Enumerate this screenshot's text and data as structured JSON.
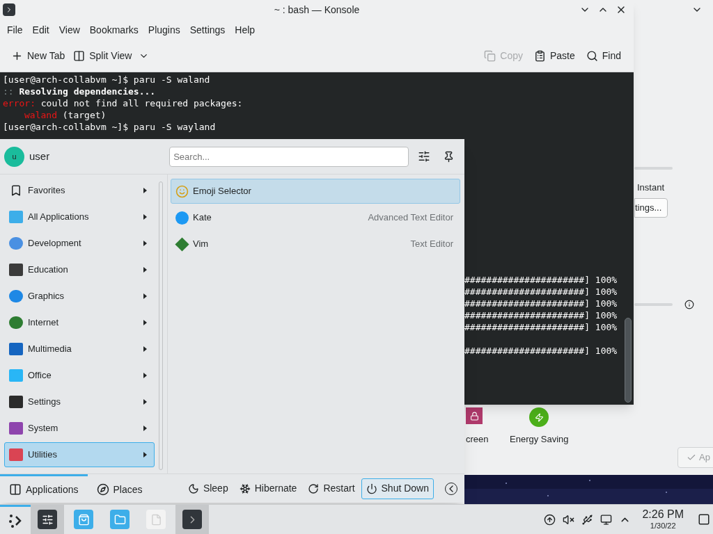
{
  "settings_window": {
    "slider_label": "Instant",
    "button": "tings...",
    "items": [
      {
        "label": "creen"
      },
      {
        "label": "Energy Saving"
      }
    ],
    "apply": "Ap"
  },
  "konsole": {
    "title": "~ : bash — Konsole",
    "menu": [
      "File",
      "Edit",
      "View",
      "Bookmarks",
      "Plugins",
      "Settings",
      "Help"
    ],
    "toolbar_left": [
      {
        "label": "New Tab",
        "kind": "new-tab"
      },
      {
        "label": "Split View",
        "kind": "split"
      }
    ],
    "toolbar_right": [
      {
        "label": "Copy",
        "kind": "copy",
        "disabled": true
      },
      {
        "label": "Paste",
        "kind": "paste",
        "disabled": false
      },
      {
        "label": "Find",
        "kind": "find",
        "disabled": false
      }
    ],
    "lines": [
      {
        "indent": false,
        "segments": [
          {
            "text": "[user@arch-collabvm ~]$ paru -S waland",
            "kind": "normal"
          }
        ]
      },
      {
        "indent": false,
        "segments": [
          {
            "text": "::",
            "kind": "dim"
          },
          {
            "text": " Resolving dependencies...",
            "kind": "bold"
          }
        ]
      },
      {
        "indent": false,
        "segments": [
          {
            "text": "error:",
            "kind": "error"
          },
          {
            "text": " could not find all required packages:",
            "kind": "normal"
          }
        ]
      },
      {
        "indent": true,
        "segments": [
          {
            "text": "waland",
            "kind": "error"
          },
          {
            "text": " (target)",
            "kind": "normal"
          }
        ]
      },
      {
        "indent": false,
        "segments": [
          {
            "text": "[user@arch-collabvm ~]$ paru -S wayland",
            "kind": "normal"
          }
        ]
      }
    ],
    "progress_groups": [
      [
        "######################] 100%",
        "######################] 100%",
        "######################] 100%",
        "######################] 100%",
        "######################] 100%"
      ],
      [
        "######################] 100%"
      ]
    ]
  },
  "launcher": {
    "user": {
      "name": "user",
      "initial": "u"
    },
    "search": {
      "placeholder": "Search..."
    },
    "categories": [
      {
        "label": "Favorites",
        "selected": false
      },
      {
        "label": "All Applications",
        "selected": false
      },
      {
        "label": "Development",
        "selected": false
      },
      {
        "label": "Education",
        "selected": false
      },
      {
        "label": "Graphics",
        "selected": false
      },
      {
        "label": "Internet",
        "selected": false
      },
      {
        "label": "Multimedia",
        "selected": false
      },
      {
        "label": "Office",
        "selected": false
      },
      {
        "label": "Settings",
        "selected": false
      },
      {
        "label": "System",
        "selected": false
      },
      {
        "label": "Utilities",
        "selected": true
      }
    ],
    "apps": [
      {
        "name": "Emoji Selector",
        "selected": true
      },
      {
        "name": "Kate",
        "description": "Advanced Text Editor",
        "selected": false
      },
      {
        "name": "Vim",
        "description": "Text Editor",
        "selected": false
      }
    ],
    "tabs": [
      {
        "label": "Applications",
        "selected": true
      },
      {
        "label": "Places",
        "selected": false
      }
    ],
    "power": [
      {
        "label": "Sleep",
        "kind": "sleep",
        "hovered": false
      },
      {
        "label": "Hibernate",
        "kind": "hibernate",
        "hovered": false
      },
      {
        "label": "Restart",
        "kind": "restart",
        "hovered": false
      },
      {
        "label": "Shut Down",
        "kind": "shutdown",
        "hovered": true
      }
    ]
  },
  "taskbar": {
    "tasks": [
      {
        "kind": "settings",
        "active": true
      },
      {
        "kind": "store",
        "active": false
      },
      {
        "kind": "folder",
        "active": false
      },
      {
        "kind": "document",
        "active": false
      },
      {
        "kind": "terminal",
        "active": true
      }
    ],
    "time": "2:26 PM",
    "date": "1/30/22"
  }
}
